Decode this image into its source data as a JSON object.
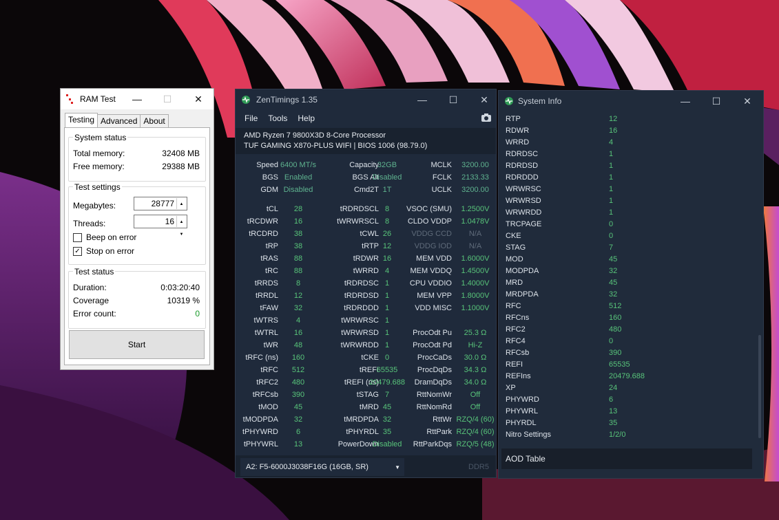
{
  "colors": {
    "accent_green": "#58c47a",
    "zen_bg": "#1f2a3b",
    "sys_bg": "#202b3b"
  },
  "ramtest": {
    "title": "RAM Test",
    "tabs": [
      "Testing",
      "Advanced",
      "About"
    ],
    "system_status": {
      "title": "System status",
      "total_label": "Total memory:",
      "total_value": "32408 MB",
      "free_label": "Free memory:",
      "free_value": "29388 MB"
    },
    "test_settings": {
      "title": "Test settings",
      "mb_label": "Megabytes:",
      "mb_value": "28777",
      "threads_label": "Threads:",
      "threads_value": "16",
      "beep_label": "Beep on error",
      "beep_checked": false,
      "stop_label": "Stop on error",
      "stop_checked": true
    },
    "test_status": {
      "title": "Test status",
      "duration_label": "Duration:",
      "duration_value": "0:03:20:40",
      "coverage_label": "Coverage",
      "coverage_value": "10319 %",
      "errors_label": "Error count:",
      "errors_value": "0"
    },
    "start_label": "Start"
  },
  "zen": {
    "title": "ZenTimings 1.35",
    "menu": [
      "File",
      "Tools",
      "Help"
    ],
    "cpu": "AMD Ryzen 7 9800X3D 8-Core Processor",
    "board": "TUF GAMING X870-PLUS WIFI | BIOS 1006 (98.79.0)",
    "top": [
      [
        "Speed",
        "6400 MT/s",
        "Capacity",
        "32GB",
        "MCLK",
        "3200.00"
      ],
      [
        "BGS",
        "Enabled",
        "BGS Alt",
        "Disabled",
        "FCLK",
        "2133.33"
      ],
      [
        "GDM",
        "Disabled",
        "Cmd2T",
        "1T",
        "UCLK",
        "3200.00"
      ]
    ],
    "rows": [
      [
        "tCL",
        "28",
        "tRDRDSCL",
        "8",
        "VSOC (SMU)",
        "1.2500V"
      ],
      [
        "tRCDWR",
        "16",
        "tWRWRSCL",
        "8",
        "CLDO VDDP",
        "1.0478V"
      ],
      [
        "tRCDRD",
        "38",
        "tCWL",
        "26",
        "VDDG CCD",
        "N/A"
      ],
      [
        "tRP",
        "38",
        "tRTP",
        "12",
        "VDDG IOD",
        "N/A"
      ],
      [
        "tRAS",
        "88",
        "tRDWR",
        "16",
        "MEM VDD",
        "1.6000V"
      ],
      [
        "tRC",
        "88",
        "tWRRD",
        "4",
        "MEM VDDQ",
        "1.4500V"
      ],
      [
        "tRRDS",
        "8",
        "tRDRDSC",
        "1",
        "CPU VDDIO",
        "1.4000V"
      ],
      [
        "tRRDL",
        "12",
        "tRDRDSD",
        "1",
        "MEM VPP",
        "1.8000V"
      ],
      [
        "tFAW",
        "32",
        "tRDRDDD",
        "1",
        "VDD MISC",
        "1.1000V"
      ],
      [
        "tWTRS",
        "4",
        "tWRWRSC",
        "1",
        "",
        ""
      ],
      [
        "tWTRL",
        "16",
        "tWRWRSD",
        "1",
        "ProcOdt Pu",
        "25.3 Ω"
      ],
      [
        "tWR",
        "48",
        "tWRWRDD",
        "1",
        "ProcOdt Pd",
        "Hi-Z"
      ],
      [
        "tRFC (ns)",
        "160",
        "tCKE",
        "0",
        "ProcCaDs",
        "30.0 Ω"
      ],
      [
        "tRFC",
        "512",
        "tREFI",
        "65535",
        "ProcDqDs",
        "34.3 Ω"
      ],
      [
        "tRFC2",
        "480",
        "tREFI (ns)",
        "20479.688",
        "DramDqDs",
        "34.0 Ω"
      ],
      [
        "tRFCsb",
        "390",
        "tSTAG",
        "7",
        "RttNomWr",
        "Off"
      ],
      [
        "tMOD",
        "45",
        "tMRD",
        "45",
        "RttNomRd",
        "Off"
      ],
      [
        "tMODPDA",
        "32",
        "tMRDPDA",
        "32",
        "RttWr",
        "RZQ/4 (60)"
      ],
      [
        "tPHYWRD",
        "6",
        "tPHYRDL",
        "35",
        "RttPark",
        "RZQ/4 (60)"
      ],
      [
        "tPHYWRL",
        "13",
        "PowerDown",
        "Disabled",
        "RttParkDqs",
        "RZQ/5 (48)"
      ]
    ],
    "dimm": "A2: F5-6000J3038F16G (16GB, SR)",
    "ddr": "DDR5"
  },
  "sysinfo": {
    "title": "System Info",
    "rows": [
      [
        "RTP",
        "12"
      ],
      [
        "RDWR",
        "16"
      ],
      [
        "WRRD",
        "4"
      ],
      [
        "RDRDSC",
        "1"
      ],
      [
        "RDRDSD",
        "1"
      ],
      [
        "RDRDDD",
        "1"
      ],
      [
        "WRWRSC",
        "1"
      ],
      [
        "WRWRSD",
        "1"
      ],
      [
        "WRWRDD",
        "1"
      ],
      [
        "TRCPAGE",
        "0"
      ],
      [
        "CKE",
        "0"
      ],
      [
        "STAG",
        "7"
      ],
      [
        "MOD",
        "45"
      ],
      [
        "MODPDA",
        "32"
      ],
      [
        "MRD",
        "45"
      ],
      [
        "MRDPDA",
        "32"
      ],
      [
        "RFC",
        "512"
      ],
      [
        "RFCns",
        "160"
      ],
      [
        "RFC2",
        "480"
      ],
      [
        "RFC4",
        "0"
      ],
      [
        "RFCsb",
        "390"
      ],
      [
        "REFI",
        "65535"
      ],
      [
        "REFIns",
        "20479.688"
      ],
      [
        "XP",
        "24"
      ],
      [
        "PHYWRD",
        "6"
      ],
      [
        "PHYWRL",
        "13"
      ],
      [
        "PHYRDL",
        "35"
      ],
      [
        "Nitro Settings",
        "1/2/0"
      ]
    ],
    "aod": "AOD Table"
  }
}
